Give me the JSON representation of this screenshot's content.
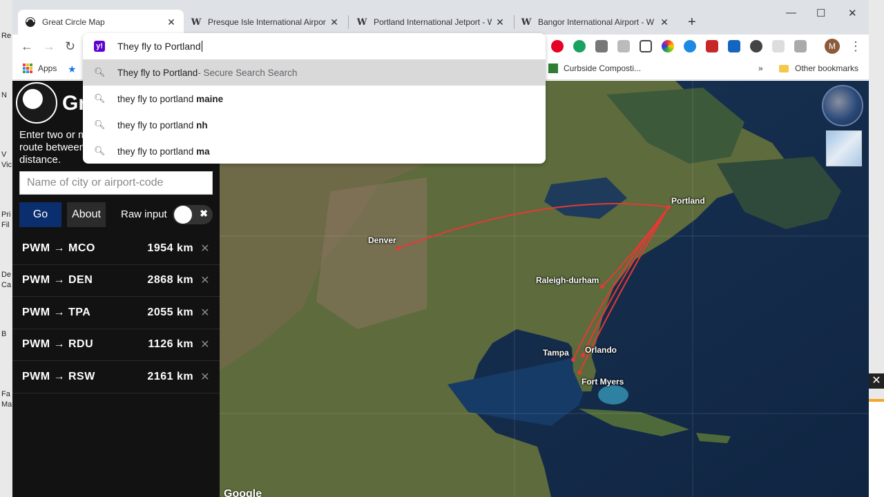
{
  "desktop": {
    "labels": [
      "Re",
      "N",
      "V",
      "Vic",
      "Pri",
      "Fil",
      "De",
      "Ca",
      "B",
      "Fa",
      "Ma"
    ]
  },
  "tabs": [
    {
      "title": "Great Circle Map",
      "icon": "great-circle-favicon"
    },
    {
      "title": "Presque Isle International Airport",
      "icon": "wikipedia-favicon",
      "glyph": "W"
    },
    {
      "title": "Portland International Jetport - W",
      "icon": "wikipedia-favicon",
      "glyph": "W"
    },
    {
      "title": "Bangor International Airport - W",
      "icon": "wikipedia-favicon",
      "glyph": "W"
    }
  ],
  "tab_close": "✕",
  "new_tab": "+",
  "window_controls": {
    "minimize": "—",
    "maximize": "☐",
    "close": "✕"
  },
  "toolbar": {
    "back": "←",
    "forward": "→",
    "reload": "↻",
    "menu": "⋮",
    "profile": "M"
  },
  "omnibox": {
    "engine_glyph": "y!",
    "value": "They fly to Portland",
    "suggestions": [
      {
        "prefix": "They fly to Portland",
        "suffix": " - Secure Search Search",
        "bold": ""
      },
      {
        "prefix": "they fly to portland ",
        "suffix": "",
        "bold": "maine"
      },
      {
        "prefix": "they fly to portland ",
        "suffix": "",
        "bold": "nh"
      },
      {
        "prefix": "they fly to portland ",
        "suffix": "",
        "bold": "ma"
      }
    ]
  },
  "bookmarks": {
    "apps": "Apps",
    "curbside": "Curbside Composti...",
    "more": "»",
    "other": "Other bookmarks"
  },
  "sidebar": {
    "logo_text": "Gr",
    "intro": "Enter two or more places to show the route between them and calculate the distance.",
    "input_placeholder": "Name of city or airport-code",
    "go_label": "Go",
    "about_label": "About",
    "raw_input_label": "Raw input",
    "toggle_glyph": "✖",
    "route_remove_glyph": "✕",
    "routes": [
      {
        "name": "PWM → MCO",
        "distance": "1954 km"
      },
      {
        "name": "PWM → DEN",
        "distance": "2868 km"
      },
      {
        "name": "PWM → TPA",
        "distance": "2055 km"
      },
      {
        "name": "PWM → RDU",
        "distance": "1126 km"
      },
      {
        "name": "PWM → RSW",
        "distance": "2161 km"
      }
    ]
  },
  "map": {
    "cities": [
      "Portland",
      "Denver",
      "Raleigh-durham",
      "Orlando",
      "Tampa",
      "Fort Myers"
    ],
    "attribution": "Google",
    "route_color": "#e53935"
  },
  "ad_close": "✕"
}
